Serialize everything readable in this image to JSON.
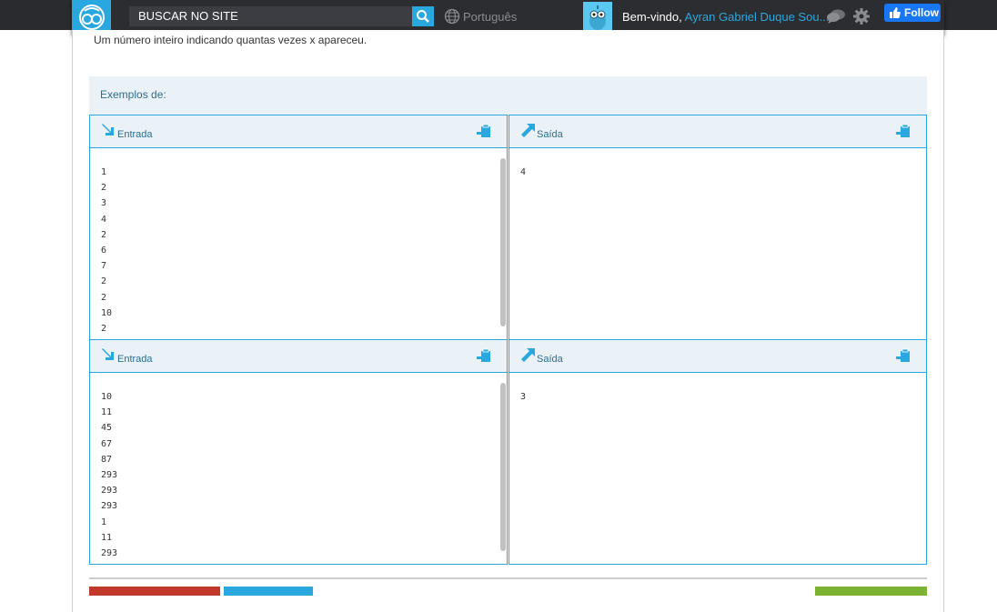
{
  "header": {
    "search_placeholder": "BUSCAR NO SITE",
    "language": "Português",
    "welcome_prefix": "Bem-vindo,",
    "user_name": "Ayran Gabriel Duque Sou...",
    "follow_label": "Follow"
  },
  "problem": {
    "output_description": "Um número inteiro indicando quantas vezes x apareceu."
  },
  "examples": {
    "heading": "Exemplos de:",
    "input_label": "Entrada",
    "output_label": "Saída",
    "cases": [
      {
        "input": [
          "1",
          "2",
          "3",
          "4",
          "2",
          "6",
          "7",
          "2",
          "2",
          "10",
          "2"
        ],
        "output": [
          "4"
        ]
      },
      {
        "input": [
          "10",
          "11",
          "45",
          "67",
          "87",
          "293",
          "293",
          "293",
          "1",
          "11",
          "293"
        ],
        "output": [
          "3"
        ]
      }
    ]
  },
  "colors": {
    "accent": "#29a8e0",
    "topbar": "#2c2d31",
    "panel_head": "#eaf2f7"
  }
}
